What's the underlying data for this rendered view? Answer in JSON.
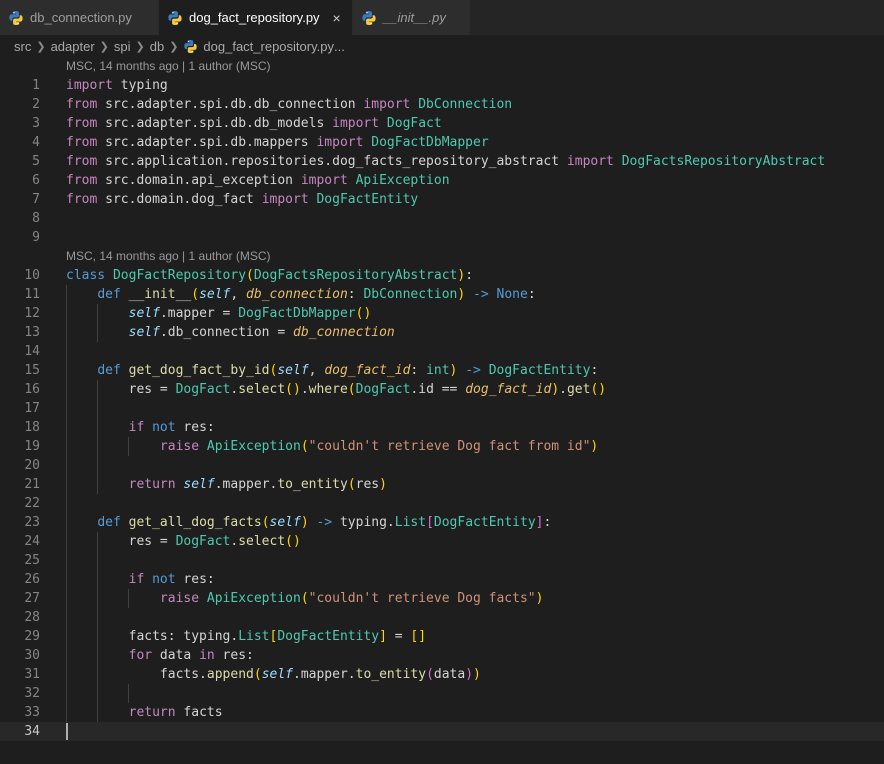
{
  "tabs": [
    {
      "label": "db_connection.py",
      "active": false,
      "italic": false,
      "icon": "python-icon"
    },
    {
      "label": "dog_fact_repository.py",
      "active": true,
      "italic": false,
      "icon": "python-icon",
      "close": "×"
    },
    {
      "label": "__init__.py",
      "active": false,
      "italic": true,
      "icon": "python-icon"
    }
  ],
  "breadcrumb": [
    "src",
    "adapter",
    "spi",
    "db",
    "dog_fact_repository.py",
    "..."
  ],
  "codelens": [
    "MSC, 14 months ago | 1 author (MSC)",
    "MSC, 14 months ago | 1 author (MSC)"
  ],
  "colors": {
    "background": "#1e1e1e",
    "keyword": "#569cd6",
    "control": "#c586c0",
    "class": "#4ec9b0",
    "function": "#dcdcaa",
    "string": "#ce9178",
    "parameter": "#e8bf6a"
  },
  "lines": [
    [
      [
        "ctl",
        "import"
      ],
      [
        "pl",
        " typing"
      ]
    ],
    [
      [
        "ctl",
        "from"
      ],
      [
        "pl",
        " src.adapter.spi.db.db_connection "
      ],
      [
        "ctl",
        "import"
      ],
      [
        "pl",
        " "
      ],
      [
        "cls",
        "DbConnection"
      ]
    ],
    [
      [
        "ctl",
        "from"
      ],
      [
        "pl",
        " src.adapter.spi.db.db_models "
      ],
      [
        "ctl",
        "import"
      ],
      [
        "pl",
        " "
      ],
      [
        "cls",
        "DogFact"
      ]
    ],
    [
      [
        "ctl",
        "from"
      ],
      [
        "pl",
        " src.adapter.spi.db.mappers "
      ],
      [
        "ctl",
        "import"
      ],
      [
        "pl",
        " "
      ],
      [
        "cls",
        "DogFactDbMapper"
      ]
    ],
    [
      [
        "ctl",
        "from"
      ],
      [
        "pl",
        " src.application.repositories.dog_facts_repository_abstract "
      ],
      [
        "ctl",
        "import"
      ],
      [
        "pl",
        " "
      ],
      [
        "cls",
        "DogFactsRepositoryAbstract"
      ]
    ],
    [
      [
        "ctl",
        "from"
      ],
      [
        "pl",
        " src.domain.api_exception "
      ],
      [
        "ctl",
        "import"
      ],
      [
        "pl",
        " "
      ],
      [
        "cls",
        "ApiException"
      ]
    ],
    [
      [
        "ctl",
        "from"
      ],
      [
        "pl",
        " src.domain.dog_fact "
      ],
      [
        "ctl",
        "import"
      ],
      [
        "pl",
        " "
      ],
      [
        "cls",
        "DogFactEntity"
      ]
    ],
    [],
    [],
    [
      [
        "kw",
        "class"
      ],
      [
        "pl",
        " "
      ],
      [
        "cls",
        "DogFactRepository"
      ],
      [
        "b1",
        "("
      ],
      [
        "cls",
        "DogFactsRepositoryAbstract"
      ],
      [
        "b1",
        ")"
      ],
      [
        "pl",
        ":"
      ]
    ],
    [
      [
        "pl",
        "    "
      ],
      [
        "kw",
        "def"
      ],
      [
        "pl",
        " "
      ],
      [
        "fn",
        "__init__"
      ],
      [
        "b1",
        "("
      ],
      [
        "self",
        "self"
      ],
      [
        "pl",
        ", "
      ],
      [
        "param",
        "db_connection"
      ],
      [
        "pl",
        ": "
      ],
      [
        "cls",
        "DbConnection"
      ],
      [
        "b1",
        ")"
      ],
      [
        "pl",
        " "
      ],
      [
        "kw",
        "->"
      ],
      [
        "pl",
        " "
      ],
      [
        "kw",
        "None"
      ],
      [
        "pl",
        ":"
      ]
    ],
    [
      [
        "pl",
        "        "
      ],
      [
        "self",
        "self"
      ],
      [
        "pl",
        ".mapper = "
      ],
      [
        "cls",
        "DogFactDbMapper"
      ],
      [
        "b1",
        "()"
      ]
    ],
    [
      [
        "pl",
        "        "
      ],
      [
        "self",
        "self"
      ],
      [
        "pl",
        ".db_connection = "
      ],
      [
        "param",
        "db_connection"
      ]
    ],
    [],
    [
      [
        "pl",
        "    "
      ],
      [
        "kw",
        "def"
      ],
      [
        "pl",
        " "
      ],
      [
        "fn",
        "get_dog_fact_by_id"
      ],
      [
        "b1",
        "("
      ],
      [
        "self",
        "self"
      ],
      [
        "pl",
        ", "
      ],
      [
        "param",
        "dog_fact_id"
      ],
      [
        "pl",
        ": "
      ],
      [
        "cls",
        "int"
      ],
      [
        "b1",
        ")"
      ],
      [
        "pl",
        " "
      ],
      [
        "kw",
        "->"
      ],
      [
        "pl",
        " "
      ],
      [
        "cls",
        "DogFactEntity"
      ],
      [
        "pl",
        ":"
      ]
    ],
    [
      [
        "pl",
        "        res = "
      ],
      [
        "cls",
        "DogFact"
      ],
      [
        "pl",
        "."
      ],
      [
        "fn",
        "select"
      ],
      [
        "b1",
        "()"
      ],
      [
        "pl",
        "."
      ],
      [
        "fn",
        "where"
      ],
      [
        "b1",
        "("
      ],
      [
        "cls",
        "DogFact"
      ],
      [
        "pl",
        ".id == "
      ],
      [
        "param",
        "dog_fact_id"
      ],
      [
        "b1",
        ")"
      ],
      [
        "pl",
        "."
      ],
      [
        "fn",
        "get"
      ],
      [
        "b1",
        "()"
      ]
    ],
    [],
    [
      [
        "pl",
        "        "
      ],
      [
        "ctl",
        "if"
      ],
      [
        "pl",
        " "
      ],
      [
        "kw",
        "not"
      ],
      [
        "pl",
        " res:"
      ]
    ],
    [
      [
        "pl",
        "            "
      ],
      [
        "ctl",
        "raise"
      ],
      [
        "pl",
        " "
      ],
      [
        "cls",
        "ApiException"
      ],
      [
        "b1",
        "("
      ],
      [
        "str",
        "\"couldn't retrieve Dog fact from id\""
      ],
      [
        "b1",
        ")"
      ]
    ],
    [],
    [
      [
        "pl",
        "        "
      ],
      [
        "ctl",
        "return"
      ],
      [
        "pl",
        " "
      ],
      [
        "self",
        "self"
      ],
      [
        "pl",
        ".mapper."
      ],
      [
        "fn",
        "to_entity"
      ],
      [
        "b1",
        "("
      ],
      [
        "pl",
        "res"
      ],
      [
        "b1",
        ")"
      ]
    ],
    [],
    [
      [
        "pl",
        "    "
      ],
      [
        "kw",
        "def"
      ],
      [
        "pl",
        " "
      ],
      [
        "fn",
        "get_all_dog_facts"
      ],
      [
        "b1",
        "("
      ],
      [
        "self",
        "self"
      ],
      [
        "b1",
        ")"
      ],
      [
        "pl",
        " "
      ],
      [
        "kw",
        "->"
      ],
      [
        "pl",
        " typing."
      ],
      [
        "cls",
        "List"
      ],
      [
        "b2",
        "["
      ],
      [
        "cls",
        "DogFactEntity"
      ],
      [
        "b2",
        "]"
      ],
      [
        "pl",
        ":"
      ]
    ],
    [
      [
        "pl",
        "        res = "
      ],
      [
        "cls",
        "DogFact"
      ],
      [
        "pl",
        "."
      ],
      [
        "fn",
        "select"
      ],
      [
        "b1",
        "()"
      ]
    ],
    [],
    [
      [
        "pl",
        "        "
      ],
      [
        "ctl",
        "if"
      ],
      [
        "pl",
        " "
      ],
      [
        "kw",
        "not"
      ],
      [
        "pl",
        " res:"
      ]
    ],
    [
      [
        "pl",
        "            "
      ],
      [
        "ctl",
        "raise"
      ],
      [
        "pl",
        " "
      ],
      [
        "cls",
        "ApiException"
      ],
      [
        "b1",
        "("
      ],
      [
        "str",
        "\"couldn't retrieve Dog facts\""
      ],
      [
        "b1",
        ")"
      ]
    ],
    [],
    [
      [
        "pl",
        "        facts: typing."
      ],
      [
        "cls",
        "List"
      ],
      [
        "b1",
        "["
      ],
      [
        "cls",
        "DogFactEntity"
      ],
      [
        "b1",
        "]"
      ],
      [
        "pl",
        " = "
      ],
      [
        "b1",
        "[]"
      ]
    ],
    [
      [
        "pl",
        "        "
      ],
      [
        "ctl",
        "for"
      ],
      [
        "pl",
        " data "
      ],
      [
        "ctl",
        "in"
      ],
      [
        "pl",
        " res:"
      ]
    ],
    [
      [
        "pl",
        "            facts."
      ],
      [
        "fn",
        "append"
      ],
      [
        "b1",
        "("
      ],
      [
        "self",
        "self"
      ],
      [
        "pl",
        ".mapper."
      ],
      [
        "fn",
        "to_entity"
      ],
      [
        "b2",
        "("
      ],
      [
        "pl",
        "data"
      ],
      [
        "b2",
        ")"
      ],
      [
        "b1",
        ")"
      ]
    ],
    [],
    [
      [
        "pl",
        "        "
      ],
      [
        "ctl",
        "return"
      ],
      [
        "pl",
        " facts"
      ]
    ],
    []
  ]
}
